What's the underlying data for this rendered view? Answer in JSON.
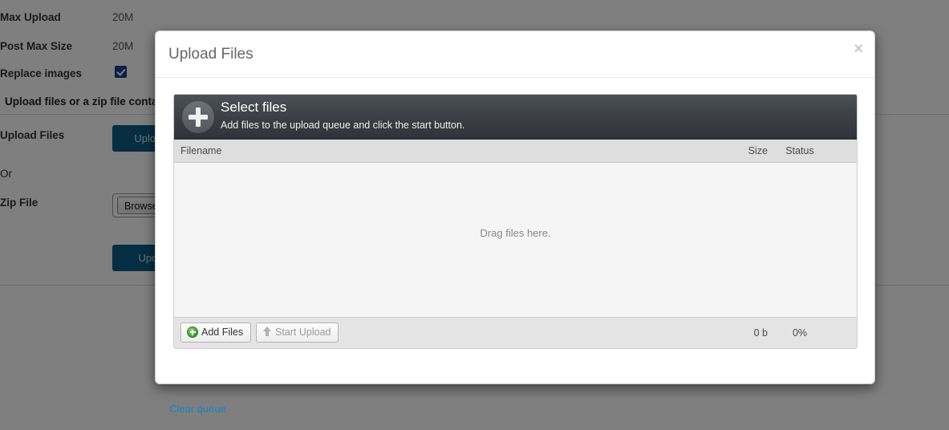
{
  "background_page": {
    "settings_rows": [
      {
        "label": "Max Upload",
        "value": "20M"
      },
      {
        "label": "Post Max Size",
        "value": "20M"
      }
    ],
    "replace_images": {
      "label": "Replace images",
      "checked": true,
      "icon": "checkbox-checked-icon"
    },
    "section_heading": "Upload files or a zip file contai",
    "upload_files": {
      "label": "Upload Files",
      "button_label": "Upload"
    },
    "or_label": "Or",
    "zip_file": {
      "label": "Zip File",
      "browse_label": "Browse",
      "value": ""
    },
    "update_button_label": "Upda",
    "accent_color": "#0a5c84",
    "checkbox_color": "#14448e"
  },
  "modal": {
    "title": "Upload Files",
    "close_icon": "close-icon",
    "close_label": "×",
    "uploader": {
      "header": {
        "icon": "plus-circle-icon",
        "title": "Select files",
        "subtitle": "Add files to the upload queue and click the start button."
      },
      "columns": {
        "filename": "Filename",
        "size": "Size",
        "status": "Status"
      },
      "droparea_text": "Drag files here.",
      "files": [],
      "footer": {
        "add_files_label": "Add Files",
        "add_files_icon": "plus-circle-green-icon",
        "start_upload_label": "Start Upload",
        "start_upload_icon": "arrow-up-icon",
        "start_upload_disabled": true,
        "total_size": "0 b",
        "total_percent": "0%"
      }
    },
    "clear_queue_label": "Clear queue",
    "link_color": "#1a82c3"
  }
}
